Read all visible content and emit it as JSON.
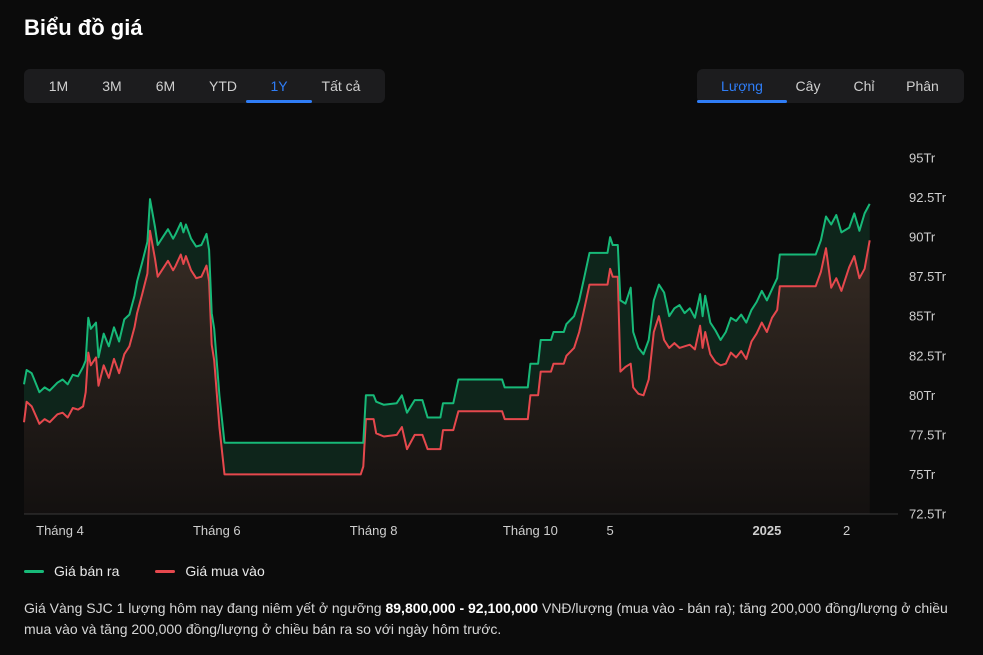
{
  "header": {
    "title": "Biểu đồ giá"
  },
  "range_tabs": [
    "1M",
    "3M",
    "6M",
    "YTD",
    "1Y",
    "Tất cả"
  ],
  "range_active": 4,
  "unit_tabs": [
    "Lượng",
    "Cây",
    "Chỉ",
    "Phân"
  ],
  "unit_active": 0,
  "colors": {
    "sell": "#17b978",
    "buy": "#e5484d",
    "accent": "#2f7df6"
  },
  "chart_data": {
    "type": "line",
    "title": "",
    "ylim": [
      72.5,
      95
    ],
    "yticks": [
      95,
      92.5,
      90,
      87.5,
      85,
      82.5,
      80,
      77.5,
      75,
      72.5
    ],
    "ytick_labels": [
      "95Tr",
      "92.5Tr",
      "90Tr",
      "87.5Tr",
      "85Tr",
      "82.5Tr",
      "80Tr",
      "77.5Tr",
      "75Tr",
      "72.5Tr"
    ],
    "x_range": [
      "2024-03-18",
      "2025-02-21"
    ],
    "xticks": [
      {
        "date": "2024-04-01",
        "label": "Tháng 4",
        "bold": false
      },
      {
        "date": "2024-06-01",
        "label": "Tháng 6",
        "bold": false
      },
      {
        "date": "2024-08-01",
        "label": "Tháng 8",
        "bold": false
      },
      {
        "date": "2024-10-01",
        "label": "Tháng 10",
        "bold": false
      },
      {
        "date": "2024-11-01",
        "label": "5",
        "bold": false
      },
      {
        "date": "2025-01-01",
        "label": "2025",
        "bold": true
      },
      {
        "date": "2025-02-01",
        "label": "2",
        "bold": false
      }
    ],
    "grid": false,
    "legend_position": "bottom-left",
    "series": [
      {
        "name": "Giá bán ra",
        "color": "#17b978",
        "points": [
          [
            "2024-03-18",
            80.7
          ],
          [
            "2024-03-19",
            81.6
          ],
          [
            "2024-03-21",
            81.4
          ],
          [
            "2024-03-24",
            80.2
          ],
          [
            "2024-03-26",
            80.5
          ],
          [
            "2024-03-28",
            80.3
          ],
          [
            "2024-03-31",
            80.8
          ],
          [
            "2024-04-02",
            81.0
          ],
          [
            "2024-04-04",
            80.7
          ],
          [
            "2024-04-06",
            81.3
          ],
          [
            "2024-04-08",
            81.2
          ],
          [
            "2024-04-10",
            81.8
          ],
          [
            "2024-04-11",
            82.2
          ],
          [
            "2024-04-12",
            84.9
          ],
          [
            "2024-04-13",
            84.2
          ],
          [
            "2024-04-15",
            84.6
          ],
          [
            "2024-04-16",
            82.4
          ],
          [
            "2024-04-18",
            83.9
          ],
          [
            "2024-04-20",
            83.1
          ],
          [
            "2024-04-22",
            84.3
          ],
          [
            "2024-04-24",
            83.4
          ],
          [
            "2024-04-26",
            84.8
          ],
          [
            "2024-04-28",
            85.1
          ],
          [
            "2024-04-30",
            86.3
          ],
          [
            "2024-05-01",
            87.2
          ],
          [
            "2024-05-03",
            88.4
          ],
          [
            "2024-05-05",
            89.7
          ],
          [
            "2024-05-06",
            92.4
          ],
          [
            "2024-05-08",
            90.6
          ],
          [
            "2024-05-09",
            89.5
          ],
          [
            "2024-05-11",
            90.0
          ],
          [
            "2024-05-13",
            90.5
          ],
          [
            "2024-05-15",
            89.9
          ],
          [
            "2024-05-16",
            90.2
          ],
          [
            "2024-05-18",
            90.9
          ],
          [
            "2024-05-19",
            90.3
          ],
          [
            "2024-05-20",
            90.8
          ],
          [
            "2024-05-22",
            89.9
          ],
          [
            "2024-05-24",
            89.4
          ],
          [
            "2024-05-26",
            89.5
          ],
          [
            "2024-05-28",
            90.2
          ],
          [
            "2024-05-29",
            89.2
          ],
          [
            "2024-05-30",
            85.2
          ],
          [
            "2024-05-31",
            84.2
          ],
          [
            "2024-06-02",
            80.0
          ],
          [
            "2024-06-04",
            77.0
          ],
          [
            "2024-06-07",
            77.0
          ],
          [
            "2024-07-28",
            77.0
          ],
          [
            "2024-07-29",
            80.0
          ],
          [
            "2024-08-01",
            80.0
          ],
          [
            "2024-08-02",
            79.6
          ],
          [
            "2024-08-05",
            79.4
          ],
          [
            "2024-08-10",
            79.5
          ],
          [
            "2024-08-12",
            80.0
          ],
          [
            "2024-08-14",
            78.9
          ],
          [
            "2024-08-17",
            79.7
          ],
          [
            "2024-08-20",
            79.7
          ],
          [
            "2024-08-22",
            78.6
          ],
          [
            "2024-08-27",
            78.6
          ],
          [
            "2024-08-28",
            79.5
          ],
          [
            "2024-09-01",
            79.5
          ],
          [
            "2024-09-03",
            81.0
          ],
          [
            "2024-09-20",
            81.0
          ],
          [
            "2024-09-21",
            80.5
          ],
          [
            "2024-09-30",
            80.5
          ],
          [
            "2024-10-01",
            82.0
          ],
          [
            "2024-10-04",
            82.0
          ],
          [
            "2024-10-05",
            83.5
          ],
          [
            "2024-10-09",
            83.5
          ],
          [
            "2024-10-10",
            84.0
          ],
          [
            "2024-10-14",
            84.0
          ],
          [
            "2024-10-15",
            84.5
          ],
          [
            "2024-10-18",
            85.0
          ],
          [
            "2024-10-20",
            86.0
          ],
          [
            "2024-10-22",
            87.5
          ],
          [
            "2024-10-24",
            89.0
          ],
          [
            "2024-10-31",
            89.0
          ],
          [
            "2024-11-01",
            90.0
          ],
          [
            "2024-11-02",
            89.5
          ],
          [
            "2024-11-04",
            89.5
          ],
          [
            "2024-11-05",
            86.0
          ],
          [
            "2024-11-07",
            85.8
          ],
          [
            "2024-11-09",
            86.8
          ],
          [
            "2024-11-10",
            84.0
          ],
          [
            "2024-11-12",
            83.0
          ],
          [
            "2024-11-14",
            82.6
          ],
          [
            "2024-11-16",
            83.5
          ],
          [
            "2024-11-18",
            86.0
          ],
          [
            "2024-11-20",
            87.0
          ],
          [
            "2024-11-22",
            86.5
          ],
          [
            "2024-11-24",
            85.0
          ],
          [
            "2024-11-26",
            85.5
          ],
          [
            "2024-11-28",
            85.7
          ],
          [
            "2024-11-30",
            85.2
          ],
          [
            "2024-12-02",
            85.5
          ],
          [
            "2024-12-04",
            84.9
          ],
          [
            "2024-12-06",
            86.4
          ],
          [
            "2024-12-07",
            85.0
          ],
          [
            "2024-12-08",
            86.3
          ],
          [
            "2024-12-10",
            84.6
          ],
          [
            "2024-12-12",
            84.1
          ],
          [
            "2024-12-14",
            83.5
          ],
          [
            "2024-12-16",
            84.0
          ],
          [
            "2024-12-18",
            84.9
          ],
          [
            "2024-12-20",
            84.7
          ],
          [
            "2024-12-22",
            85.1
          ],
          [
            "2024-12-24",
            84.6
          ],
          [
            "2024-12-26",
            85.4
          ],
          [
            "2024-12-28",
            85.9
          ],
          [
            "2024-12-30",
            86.6
          ],
          [
            "2025-01-01",
            86.0
          ],
          [
            "2025-01-03",
            86.7
          ],
          [
            "2025-01-05",
            87.4
          ],
          [
            "2025-01-06",
            88.9
          ],
          [
            "2025-01-20",
            88.9
          ],
          [
            "2025-01-22",
            89.8
          ],
          [
            "2025-01-24",
            91.3
          ],
          [
            "2025-01-26",
            90.8
          ],
          [
            "2025-01-28",
            91.4
          ],
          [
            "2025-01-30",
            90.3
          ],
          [
            "2025-02-02",
            90.6
          ],
          [
            "2025-02-04",
            91.5
          ],
          [
            "2025-02-06",
            90.4
          ],
          [
            "2025-02-08",
            91.5
          ],
          [
            "2025-02-10",
            92.1
          ]
        ]
      },
      {
        "name": "Giá mua vào",
        "color": "#e5484d",
        "points": [
          [
            "2024-03-18",
            78.3
          ],
          [
            "2024-03-19",
            79.6
          ],
          [
            "2024-03-21",
            79.3
          ],
          [
            "2024-03-24",
            78.2
          ],
          [
            "2024-03-26",
            78.5
          ],
          [
            "2024-03-28",
            78.3
          ],
          [
            "2024-03-31",
            78.8
          ],
          [
            "2024-04-02",
            78.9
          ],
          [
            "2024-04-04",
            78.6
          ],
          [
            "2024-04-06",
            79.2
          ],
          [
            "2024-04-08",
            79.1
          ],
          [
            "2024-04-10",
            79.3
          ],
          [
            "2024-04-11",
            80.2
          ],
          [
            "2024-04-12",
            82.7
          ],
          [
            "2024-04-13",
            81.9
          ],
          [
            "2024-04-15",
            82.4
          ],
          [
            "2024-04-16",
            80.6
          ],
          [
            "2024-04-18",
            81.9
          ],
          [
            "2024-04-20",
            81.1
          ],
          [
            "2024-04-22",
            82.3
          ],
          [
            "2024-04-24",
            81.4
          ],
          [
            "2024-04-26",
            82.6
          ],
          [
            "2024-04-28",
            83.1
          ],
          [
            "2024-04-30",
            84.3
          ],
          [
            "2024-05-01",
            85.2
          ],
          [
            "2024-05-03",
            86.4
          ],
          [
            "2024-05-05",
            87.7
          ],
          [
            "2024-05-06",
            90.4
          ],
          [
            "2024-05-08",
            88.6
          ],
          [
            "2024-05-09",
            87.5
          ],
          [
            "2024-05-11",
            88.0
          ],
          [
            "2024-05-13",
            88.5
          ],
          [
            "2024-05-15",
            87.9
          ],
          [
            "2024-05-16",
            88.2
          ],
          [
            "2024-05-18",
            88.9
          ],
          [
            "2024-05-19",
            88.3
          ],
          [
            "2024-05-20",
            88.8
          ],
          [
            "2024-05-22",
            87.9
          ],
          [
            "2024-05-24",
            87.4
          ],
          [
            "2024-05-26",
            87.5
          ],
          [
            "2024-05-28",
            88.2
          ],
          [
            "2024-05-29",
            87.2
          ],
          [
            "2024-05-30",
            83.2
          ],
          [
            "2024-05-31",
            82.2
          ],
          [
            "2024-06-02",
            78.0
          ],
          [
            "2024-06-04",
            75.0
          ],
          [
            "2024-06-07",
            75.0
          ],
          [
            "2024-07-27",
            75.0
          ],
          [
            "2024-07-28",
            75.5
          ],
          [
            "2024-07-29",
            78.5
          ],
          [
            "2024-08-01",
            78.5
          ],
          [
            "2024-08-02",
            77.6
          ],
          [
            "2024-08-05",
            77.4
          ],
          [
            "2024-08-10",
            77.5
          ],
          [
            "2024-08-12",
            78.0
          ],
          [
            "2024-08-14",
            76.6
          ],
          [
            "2024-08-17",
            77.5
          ],
          [
            "2024-08-20",
            77.5
          ],
          [
            "2024-08-22",
            76.6
          ],
          [
            "2024-08-27",
            76.6
          ],
          [
            "2024-08-28",
            77.8
          ],
          [
            "2024-09-01",
            77.8
          ],
          [
            "2024-09-03",
            79.0
          ],
          [
            "2024-09-20",
            79.0
          ],
          [
            "2024-09-21",
            78.5
          ],
          [
            "2024-09-30",
            78.5
          ],
          [
            "2024-10-01",
            80.0
          ],
          [
            "2024-10-04",
            80.0
          ],
          [
            "2024-10-05",
            81.5
          ],
          [
            "2024-10-09",
            81.5
          ],
          [
            "2024-10-10",
            82.0
          ],
          [
            "2024-10-14",
            82.0
          ],
          [
            "2024-10-15",
            82.5
          ],
          [
            "2024-10-18",
            83.0
          ],
          [
            "2024-10-20",
            84.0
          ],
          [
            "2024-10-22",
            85.5
          ],
          [
            "2024-10-24",
            87.0
          ],
          [
            "2024-10-31",
            87.0
          ],
          [
            "2024-11-01",
            88.0
          ],
          [
            "2024-11-02",
            87.5
          ],
          [
            "2024-11-04",
            87.5
          ],
          [
            "2024-11-05",
            81.5
          ],
          [
            "2024-11-07",
            81.8
          ],
          [
            "2024-11-09",
            82.0
          ],
          [
            "2024-11-10",
            80.5
          ],
          [
            "2024-11-12",
            80.1
          ],
          [
            "2024-11-14",
            80.0
          ],
          [
            "2024-11-16",
            81.0
          ],
          [
            "2024-11-18",
            84.0
          ],
          [
            "2024-11-20",
            85.0
          ],
          [
            "2024-11-22",
            83.5
          ],
          [
            "2024-11-24",
            83.0
          ],
          [
            "2024-11-26",
            83.3
          ],
          [
            "2024-11-28",
            83.0
          ],
          [
            "2024-11-30",
            83.1
          ],
          [
            "2024-12-02",
            83.2
          ],
          [
            "2024-12-04",
            82.9
          ],
          [
            "2024-12-06",
            84.4
          ],
          [
            "2024-12-07",
            83.0
          ],
          [
            "2024-12-08",
            84.0
          ],
          [
            "2024-12-10",
            82.6
          ],
          [
            "2024-12-12",
            82.1
          ],
          [
            "2024-12-14",
            81.9
          ],
          [
            "2024-12-16",
            82.0
          ],
          [
            "2024-12-18",
            82.7
          ],
          [
            "2024-12-20",
            82.4
          ],
          [
            "2024-12-22",
            82.8
          ],
          [
            "2024-12-24",
            82.3
          ],
          [
            "2024-12-26",
            83.4
          ],
          [
            "2024-12-28",
            83.9
          ],
          [
            "2024-12-30",
            84.6
          ],
          [
            "2025-01-01",
            84.0
          ],
          [
            "2025-01-03",
            84.9
          ],
          [
            "2025-01-05",
            85.4
          ],
          [
            "2025-01-06",
            86.9
          ],
          [
            "2025-01-20",
            86.9
          ],
          [
            "2025-01-22",
            87.8
          ],
          [
            "2025-01-24",
            89.3
          ],
          [
            "2025-01-26",
            86.8
          ],
          [
            "2025-01-28",
            87.4
          ],
          [
            "2025-01-30",
            86.6
          ],
          [
            "2025-02-02",
            88.1
          ],
          [
            "2025-02-04",
            88.8
          ],
          [
            "2025-02-06",
            87.4
          ],
          [
            "2025-02-08",
            88.0
          ],
          [
            "2025-02-10",
            89.8
          ]
        ]
      }
    ]
  },
  "legend": {
    "sell": "Giá bán ra",
    "buy": "Giá mua vào"
  },
  "description": {
    "p1": "Giá Vàng SJC 1 lượng hôm nay đang niêm yết ở ngưỡng ",
    "range": "89,800,000 - 92,100,000",
    "p2": " VNĐ/lượng (mua vào - bán ra); tăng 200,000 đồng/lượng ở chiều mua vào và tăng 200,000 đồng/lượng ở chiều bán ra so với ngày hôm trước."
  }
}
